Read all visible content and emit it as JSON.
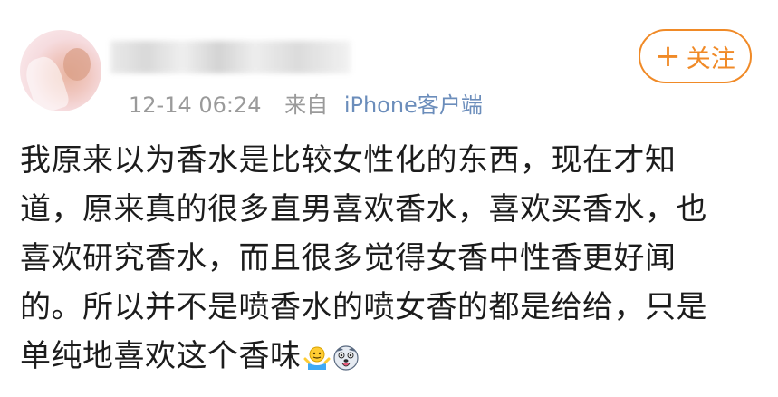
{
  "post": {
    "timestamp": "12-14 06:24",
    "source_prefix": "来自",
    "device": "iPhone客户端",
    "follow_label": "关注",
    "follow_plus": "+",
    "lines": [
      "我原来以为香水是比较女性化的东西，现在才知",
      "道，原来真的很多直男喜欢香水，喜欢买香水，也",
      "喜欢研究香水，而且很多觉得女香中性香更好闻",
      "的。所以并不是喷香水的喷女香的都是给给，只是",
      "单纯地喜欢这个香味"
    ],
    "emojis": [
      "shrug-emoji-icon",
      "dog-face-emoji-icon"
    ]
  },
  "colors": {
    "accent": "#f08a27",
    "meta_text": "#9a9a9a",
    "device_link": "#6b8dbb",
    "body_text": "#1c1c1c"
  }
}
